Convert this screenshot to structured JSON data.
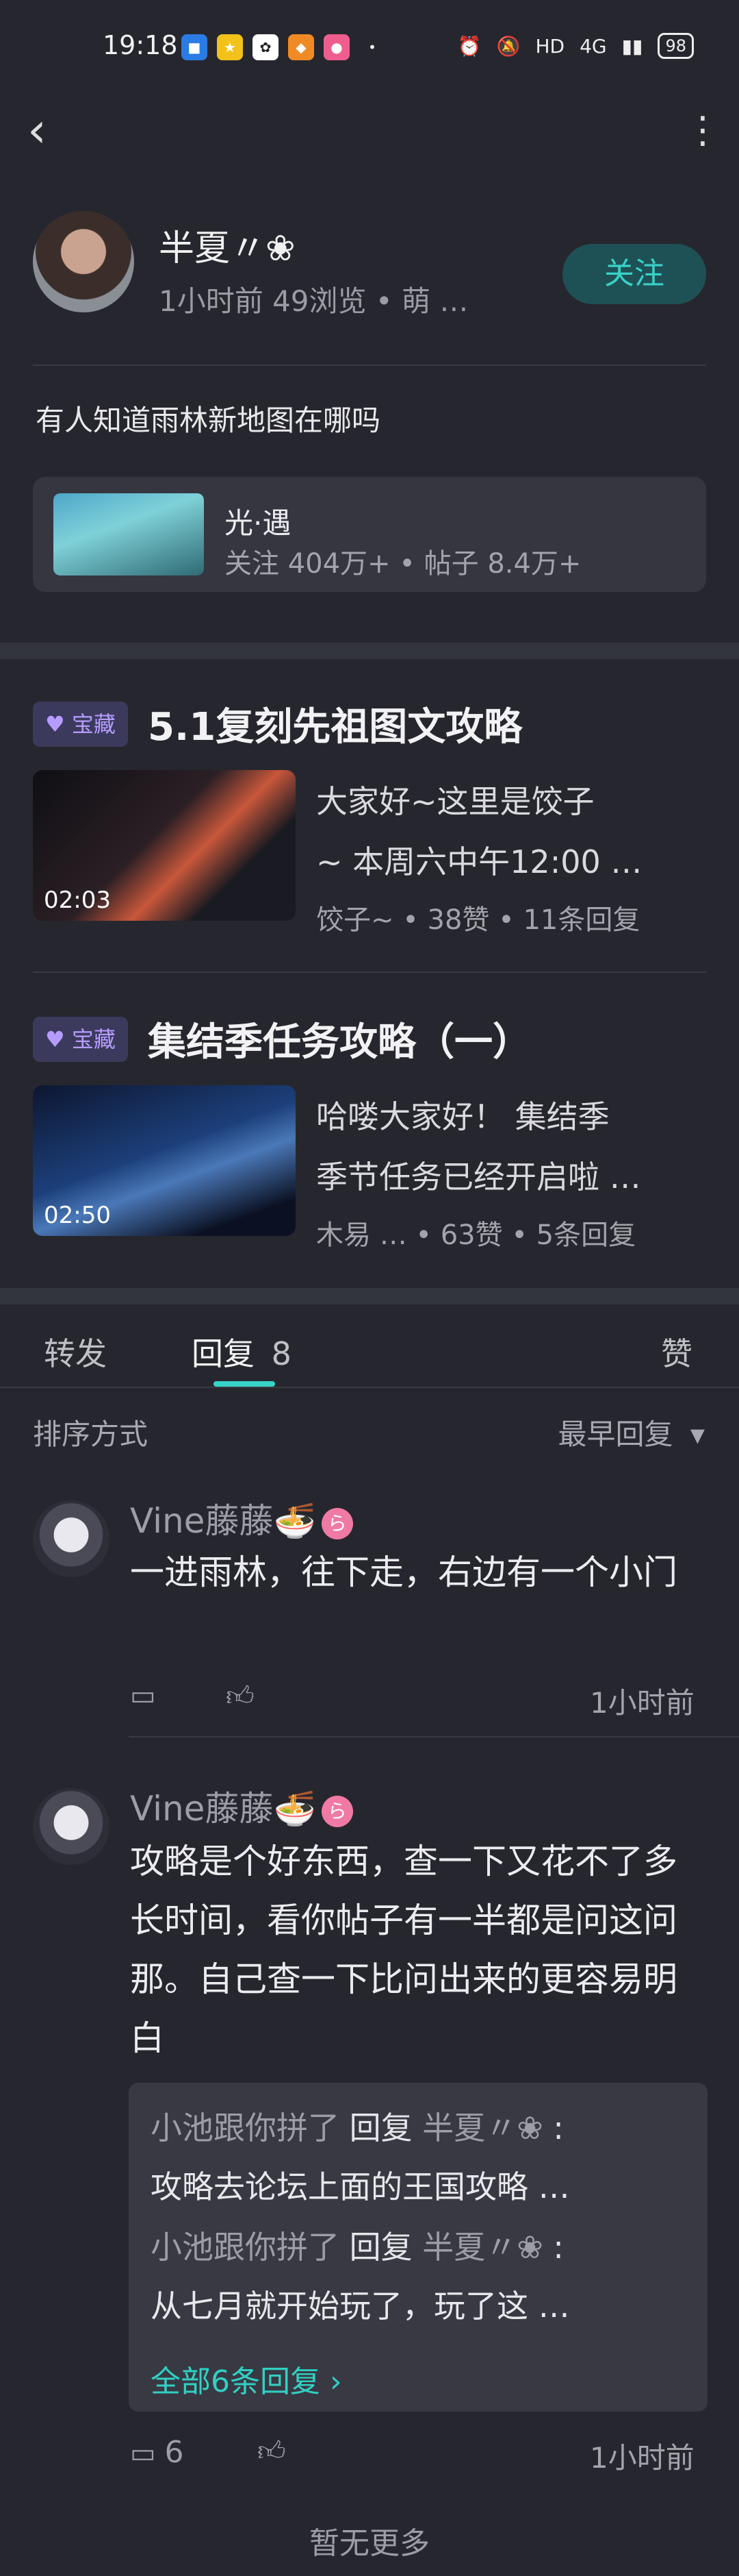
{
  "status_bar": {
    "time": "19:18",
    "battery": "98",
    "network": "4G",
    "hd": "HD"
  },
  "post": {
    "author_name": "半夏〃❀",
    "meta": "1小时前 49浏览 • 萌 …",
    "follow_label": "关注",
    "text": "有人知道雨林新地图在哪吗",
    "topic": {
      "title": "光·遇",
      "stats": "关注 404万+ • 帖子 8.4万+"
    }
  },
  "guides": [
    {
      "badge": "♥ 宝藏",
      "title": "5.1复刻先祖图文攻略",
      "duration": "02:03",
      "desc_line1": "大家好~这里是饺子",
      "desc_line2": "~ 本周六中午12:00 …",
      "meta": "饺子~ • 38赞 • 11条回复"
    },
    {
      "badge": "♥ 宝藏",
      "title": "集结季任务攻略（一）",
      "duration": "02:50",
      "desc_line1": "哈喽大家好！ 集结季",
      "desc_line2": "季节任务已经开启啦 …",
      "meta": "木易 … • 63赞 • 5条回复"
    }
  ],
  "tabs": {
    "repost": "转发",
    "reply": "回复",
    "reply_count": "8",
    "like": "赞"
  },
  "sort": {
    "label": "排序方式",
    "value": "最早回复"
  },
  "comments": [
    {
      "name": "Vine藤藤🍜",
      "text": "一进雨林，往下走，右边有一个小门",
      "time": "1小时前",
      "reply_count": ""
    },
    {
      "name": "Vine藤藤🍜",
      "text": "攻略是个好东西，查一下又花不了多长时间，看你帖子有一半都是问这问那。自己查一下比问出来的更容易明白",
      "time": "1小时前",
      "reply_count": "6",
      "replies": [
        {
          "from": "小池跟你拼了",
          "verb": "回复",
          "to": "半夏〃❀",
          "text": "攻略去论坛上面的王国攻略 …"
        },
        {
          "from": "小池跟你拼了",
          "verb": "回复",
          "to": "半夏〃❀",
          "text": "从七月就开始玩了，玩了这 …"
        }
      ],
      "all_replies": "全部6条回复 ›"
    }
  ],
  "footer": "暂无更多"
}
